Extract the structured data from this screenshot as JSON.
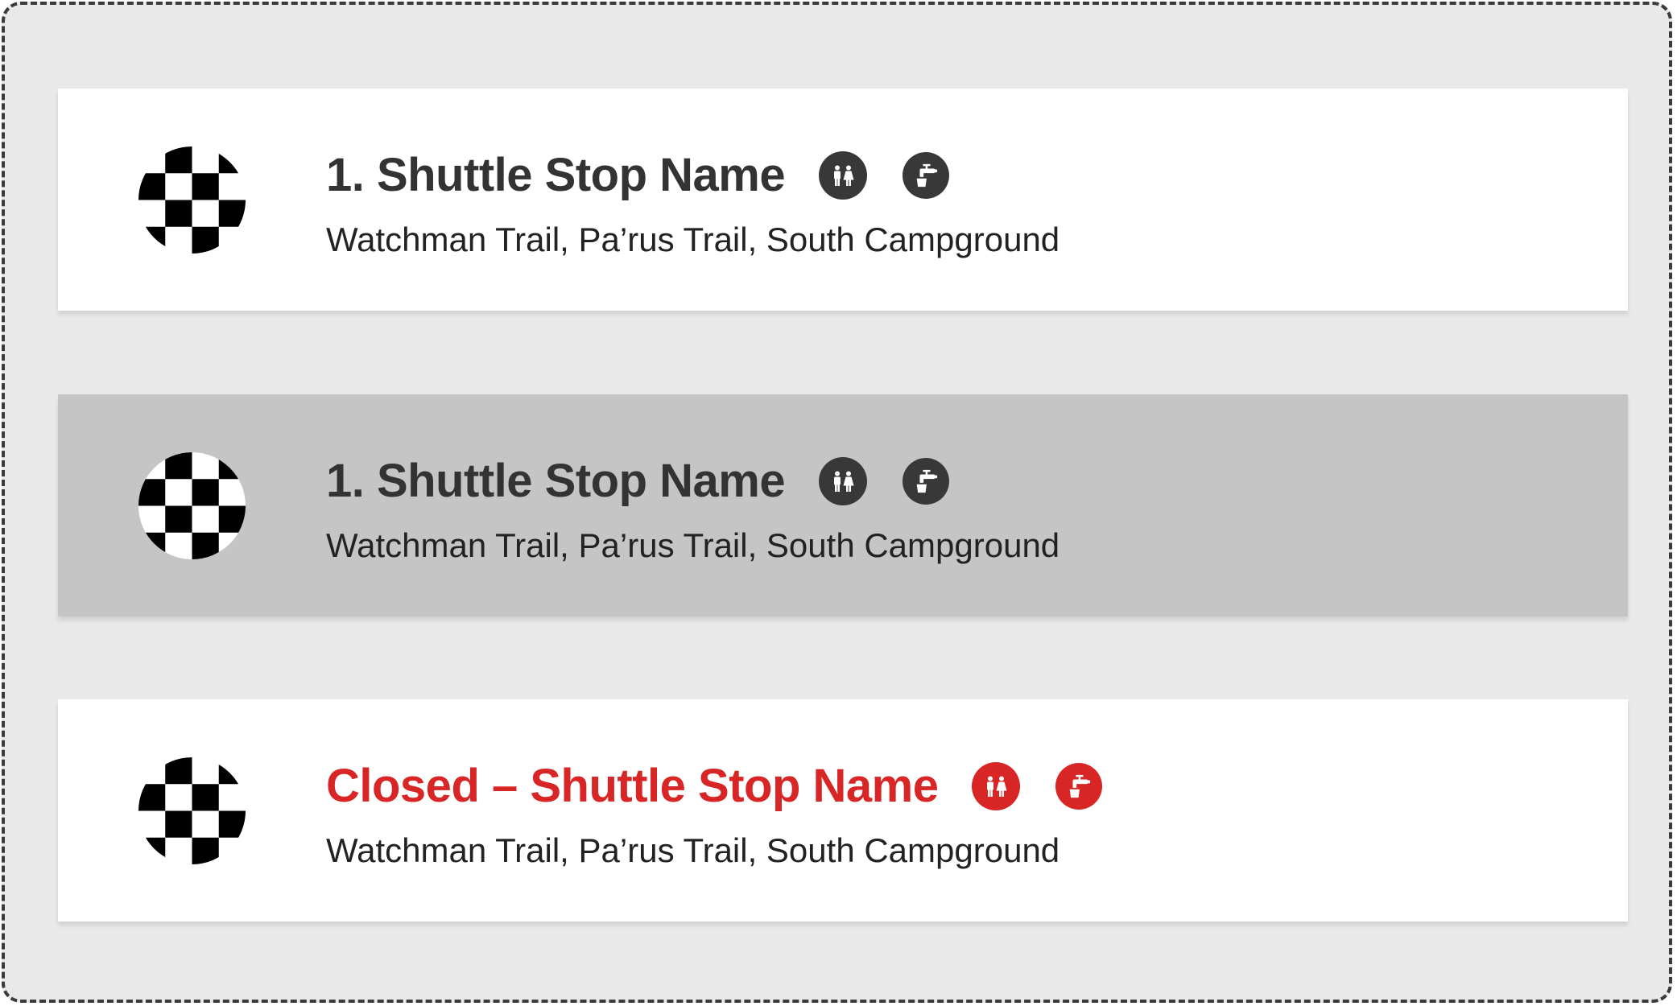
{
  "colors": {
    "frame_background": "#e9e9e9",
    "frame_border": "#3a3a3a",
    "card_default": "#ffffff",
    "card_selected": "#c5c5c5",
    "title_default": "#333333",
    "closed_accent": "#d82626",
    "icon_badge": "#383838"
  },
  "stops": [
    {
      "state": "default",
      "marker_icon": "checkered-flag-icon",
      "title": "1. Shuttle Stop Name",
      "amenities": [
        "restroom-icon",
        "water-tap-icon"
      ],
      "subtitle": "Watchman Trail, Pa’rus Trail, South Campground"
    },
    {
      "state": "selected",
      "marker_icon": "checkered-flag-icon",
      "title": "1. Shuttle Stop Name",
      "amenities": [
        "restroom-icon",
        "water-tap-icon"
      ],
      "subtitle": "Watchman Trail, Pa’rus Trail, South Campground"
    },
    {
      "state": "closed",
      "marker_icon": "checkered-flag-icon",
      "title": "Closed – Shuttle Stop Name",
      "amenities": [
        "restroom-icon",
        "water-tap-icon"
      ],
      "subtitle": "Watchman Trail, Pa’rus Trail, South Campground"
    }
  ]
}
